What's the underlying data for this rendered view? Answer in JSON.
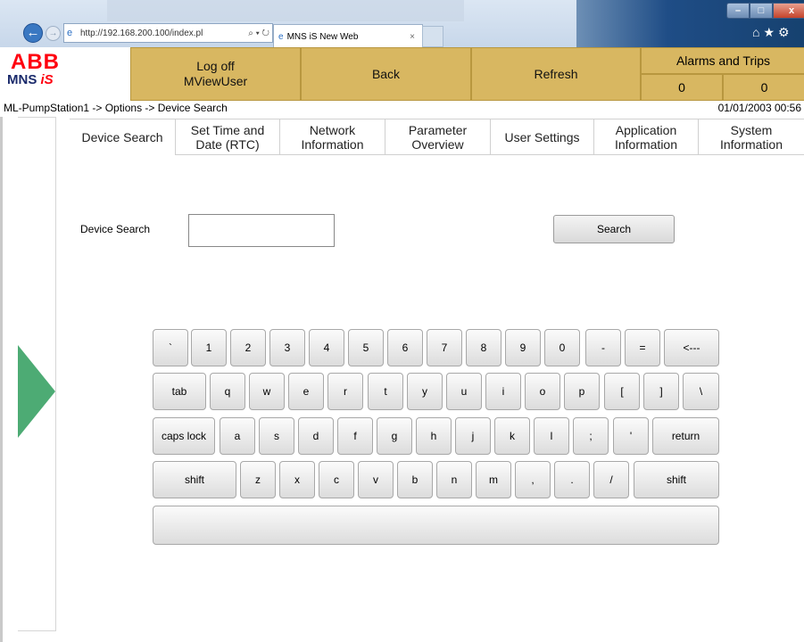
{
  "browser": {
    "url": "http://192.168.200.100/index.pl",
    "tab_title": "MNS iS New Web",
    "tab_close": "×"
  },
  "header": {
    "logo_abb": "ABB",
    "logo_mns": "MNS",
    "logo_is": "iS",
    "logoff_line1": "Log off",
    "logoff_line2": "MViewUser",
    "back": "Back",
    "refresh": "Refresh",
    "alarms_title": "Alarms and Trips",
    "alarms_value": "0",
    "trips_value": "0"
  },
  "breadcrumb": "ML-PumpStation1 -> Options -> Device Search",
  "datetime": "01/01/2003 00:56",
  "tabs": [
    {
      "line1": "Device Search",
      "line2": ""
    },
    {
      "line1": "Set Time and",
      "line2": "Date (RTC)"
    },
    {
      "line1": "Network",
      "line2": "Information"
    },
    {
      "line1": "Parameter",
      "line2": "Overview"
    },
    {
      "line1": "User Settings",
      "line2": ""
    },
    {
      "line1": "Application",
      "line2": "Information"
    },
    {
      "line1": "System",
      "line2": "Information"
    }
  ],
  "device_search": {
    "label": "Device Search",
    "value": "",
    "button": "Search"
  },
  "keyboard": {
    "row1": [
      "`",
      "1",
      "2",
      "3",
      "4",
      "5",
      "6",
      "7",
      "8",
      "9",
      "0",
      "-",
      "=",
      "<---"
    ],
    "row2": [
      "tab",
      "q",
      "w",
      "e",
      "r",
      "t",
      "y",
      "u",
      "i",
      "o",
      "p",
      "[",
      "]",
      "\\"
    ],
    "row3": [
      "caps lock",
      "a",
      "s",
      "d",
      "f",
      "g",
      "h",
      "j",
      "k",
      "l",
      ";",
      "'",
      "return"
    ],
    "row4": [
      "shift",
      "z",
      "x",
      "c",
      "v",
      "b",
      "n",
      "m",
      ",",
      ".",
      "/",
      "shift"
    ],
    "space": ""
  }
}
